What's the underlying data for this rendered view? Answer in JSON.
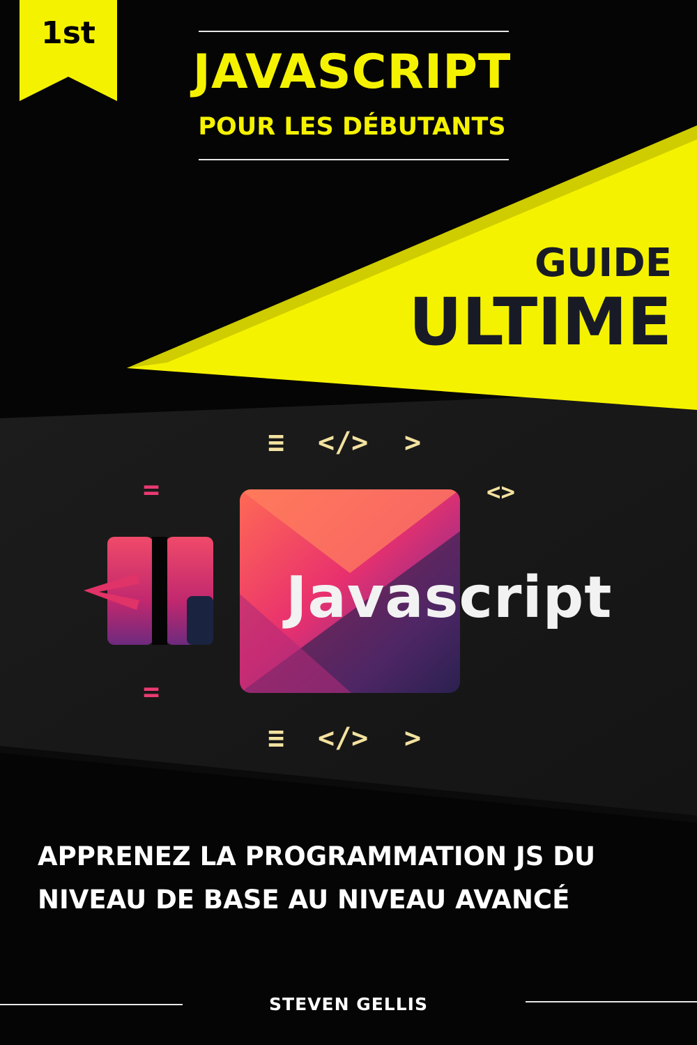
{
  "badge": {
    "text": "1st",
    "color": "#f5f200"
  },
  "header": {
    "title": "JAVASCRIPT",
    "subtitle": "POUR LES DÉBUTANTS"
  },
  "highlight": {
    "line1": "GUIDE",
    "line2": "ULTIME"
  },
  "illustration": {
    "card_label": "Javascript",
    "deco_top": [
      "≡",
      "</>",
      ">"
    ],
    "deco_right": "<>",
    "deco_bottom": [
      "≡",
      "</>",
      ">"
    ],
    "deco_left_top": "=",
    "deco_left_bottom": "="
  },
  "tagline": "APPRENEZ LA PROGRAMMATION JS DU NIVEAU DE BASE AU NIVEAU AVANCÉ",
  "author": "STEVEN GELLIS",
  "colors": {
    "accent_yellow": "#f5f200",
    "dark_text": "#181b26",
    "pink": "#ea3a72",
    "purple": "#7a2a8a"
  }
}
